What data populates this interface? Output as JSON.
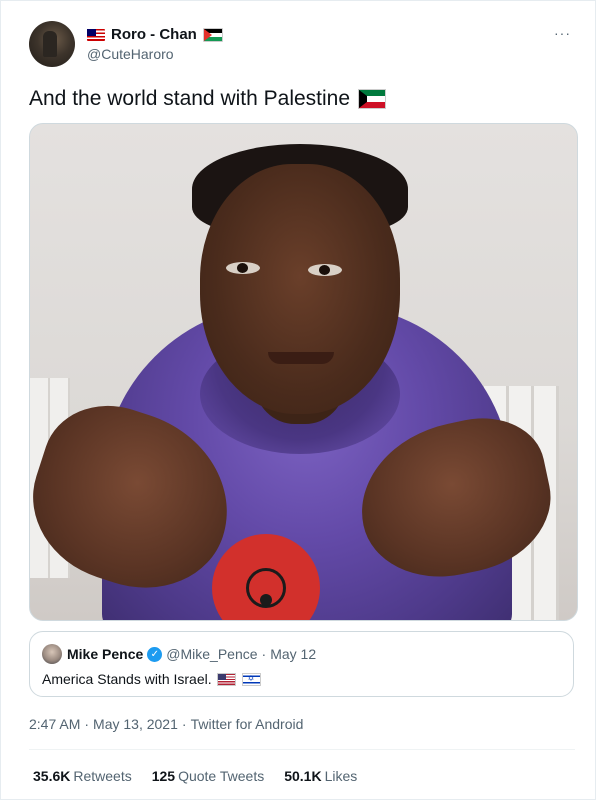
{
  "author": {
    "display_name": "Roro - Chan",
    "handle": "@CuteHaroro"
  },
  "tweet": {
    "text": "And the world stand with Palestine"
  },
  "menu": {
    "more_label": "···"
  },
  "quoted_tweet": {
    "name": "Mike Pence",
    "handle": "@Mike_Pence",
    "separator": "·",
    "date": "May 12",
    "text": "America Stands with Israel."
  },
  "meta": {
    "time": "2:47 AM",
    "separator1": "·",
    "date": "May 13, 2021",
    "separator2": "·",
    "source": "Twitter for Android"
  },
  "stats": {
    "retweets_count": "35.6K",
    "retweets_label": "Retweets",
    "quotes_count": "125",
    "quotes_label": "Quote Tweets",
    "likes_count": "50.1K",
    "likes_label": "Likes"
  },
  "icons": {
    "verified": "verified-badge-icon",
    "flags": [
      "malaysia-flag-icon",
      "palestine-flag-icon",
      "kuwait-flag-icon",
      "us-flag-icon",
      "israel-flag-icon"
    ]
  },
  "colors": {
    "text_primary": "#0f1419",
    "text_secondary": "#536471",
    "verified_blue": "#1d9bf0",
    "border": "#cfd9de"
  }
}
